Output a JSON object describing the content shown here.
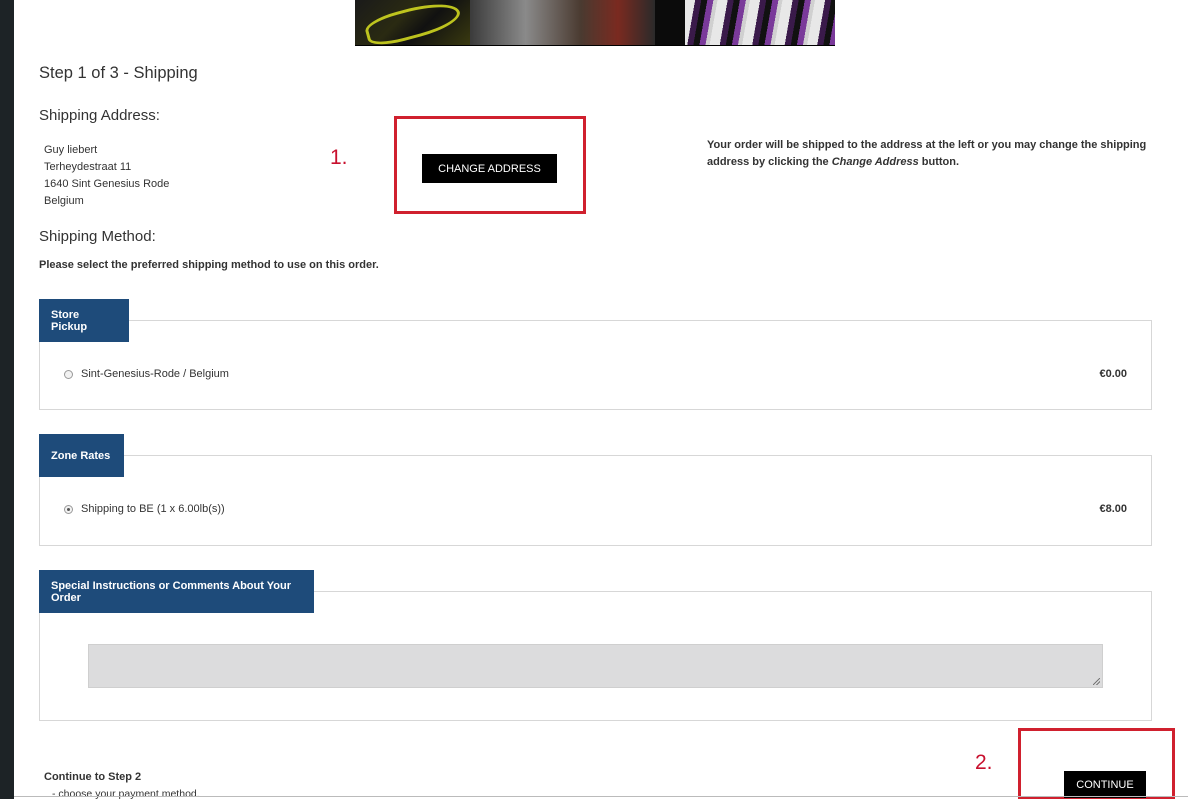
{
  "step_title": "Step 1 of 3 - Shipping",
  "shipping_address": {
    "heading": "Shipping Address:",
    "lines": [
      "Guy liebert",
      "Terheydestraat 11",
      "1640 Sint Genesius Rode",
      "Belgium"
    ],
    "change_button": "CHANGE ADDRESS",
    "note_prefix": "Your order will be shipped to the address at the left or you may change the shipping address by clicking the ",
    "note_emphasis": "Change Address",
    "note_suffix": " button."
  },
  "annotations": {
    "first": "1.",
    "second": "2.",
    "color": "#d0202e"
  },
  "shipping_method": {
    "heading": "Shipping Method:",
    "note": "Please select the preferred shipping method to use on this order.",
    "groups": [
      {
        "title": "Store Pickup",
        "option": "Sint-Genesius-Rode / Belgium",
        "price": "€0.00",
        "selected": false
      },
      {
        "title": "Zone Rates",
        "option": "Shipping to BE (1 x 6.00lb(s))",
        "price": "€8.00",
        "selected": true
      }
    ]
  },
  "comments": {
    "title": "Special Instructions or Comments About Your Order",
    "value": ""
  },
  "continue": {
    "label": "Continue to Step 2",
    "sub": "- choose your payment method.",
    "button": "CONTINUE"
  },
  "colors": {
    "legend_bg": "#1e4b7a",
    "button_bg": "#000000",
    "sidebar": "#1d2326"
  }
}
